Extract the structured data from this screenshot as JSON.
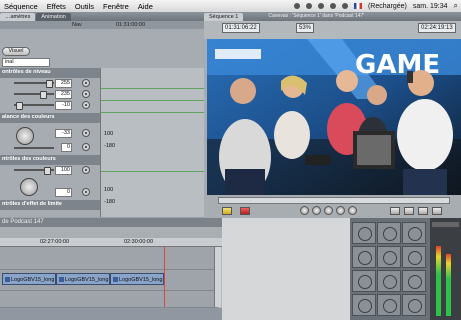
{
  "menubar": {
    "items": [
      "Séquence",
      "Effets",
      "Outils",
      "Fenêtre",
      "Aide"
    ],
    "battery": "(Rechargée)",
    "clock": "sam. 19:34"
  },
  "viewer": {
    "tabs": [
      "…amètres",
      "Animation"
    ],
    "tab_right_label": "Nav",
    "header_timecode": "01:31:00:00",
    "visual_button": "Visuel",
    "mode_select": "inal",
    "sections": {
      "levels": "ontrôles de niveau",
      "color_balance": "alance des couleurs",
      "colors": "ntrôles des couleurs",
      "limit": "ntrôles d'effet de limite"
    },
    "level_rows": [
      {
        "value": "255"
      },
      {
        "value": "235"
      },
      {
        "value": "-10"
      }
    ],
    "balance_value": "-33",
    "colors_rows": [
      {
        "value": "100"
      },
      {
        "value": "0"
      }
    ],
    "graph_values": [
      "100",
      "-180",
      "100",
      "-180"
    ]
  },
  "canvas": {
    "tabs": [
      "Séquence 1"
    ],
    "title": "Canevas : 'Séquence 1' dans 'Podcast 147'",
    "timecode_left": "01:31:06:22",
    "zoom": "53%",
    "timecode_right": "02:24:19:13",
    "logo_text": "GAME"
  },
  "timeline": {
    "title": "de Podcast 147",
    "ruler_times": [
      "02:27:00:00",
      "02:30:00:00"
    ],
    "clips": [
      "LogoGBV15_long",
      "LogoGBV15_long",
      "LogoGBV15_long"
    ]
  },
  "colors": {
    "accent_video_blue": "#1f7fd4",
    "panel_gray": "#a6acb2"
  }
}
